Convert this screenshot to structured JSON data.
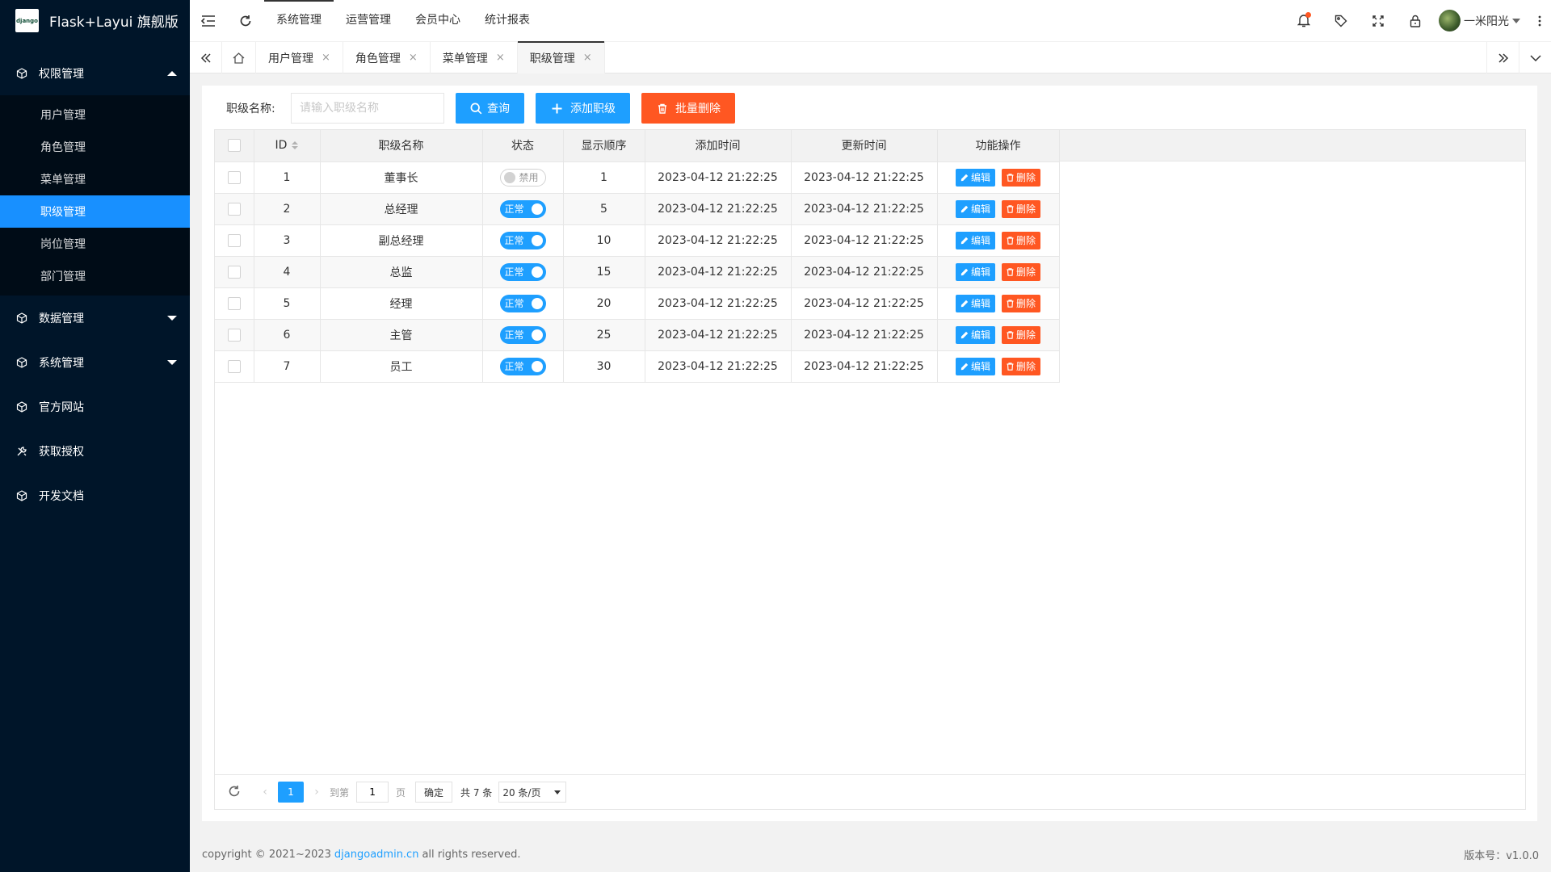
{
  "app": {
    "logo_text": "django",
    "title": "Flask+Layui 旗舰版"
  },
  "sidebar": {
    "groups": [
      {
        "label": "权限管理",
        "items": [
          "用户管理",
          "角色管理",
          "菜单管理",
          "职级管理",
          "岗位管理",
          "部门管理"
        ],
        "active_item": "职级管理"
      },
      {
        "label": "数据管理"
      },
      {
        "label": "系统管理"
      },
      {
        "label": "官方网站"
      },
      {
        "label": "获取授权"
      },
      {
        "label": "开发文档"
      }
    ]
  },
  "header": {
    "nav": [
      "系统管理",
      "运营管理",
      "会员中心",
      "统计报表"
    ],
    "active_nav": "系统管理",
    "user_name": "一米阳光"
  },
  "tabs": [
    {
      "label": "用户管理"
    },
    {
      "label": "角色管理"
    },
    {
      "label": "菜单管理"
    },
    {
      "label": "职级管理",
      "active": true
    }
  ],
  "search": {
    "label": "职级名称:",
    "placeholder": "请输入职级名称",
    "query_button": "查询",
    "add_button": "添加职级",
    "batch_delete_button": "批量删除"
  },
  "table": {
    "columns": [
      "ID",
      "职级名称",
      "状态",
      "显示顺序",
      "添加时间",
      "更新时间",
      "功能操作"
    ],
    "rows": [
      {
        "id": "1",
        "name": "董事长",
        "status": "禁用",
        "status_on": false,
        "order": "1",
        "created": "2023-04-12 21:22:25",
        "updated": "2023-04-12 21:22:25"
      },
      {
        "id": "2",
        "name": "总经理",
        "status": "正常",
        "status_on": true,
        "order": "5",
        "created": "2023-04-12 21:22:25",
        "updated": "2023-04-12 21:22:25"
      },
      {
        "id": "3",
        "name": "副总经理",
        "status": "正常",
        "status_on": true,
        "order": "10",
        "created": "2023-04-12 21:22:25",
        "updated": "2023-04-12 21:22:25"
      },
      {
        "id": "4",
        "name": "总监",
        "status": "正常",
        "status_on": true,
        "order": "15",
        "created": "2023-04-12 21:22:25",
        "updated": "2023-04-12 21:22:25"
      },
      {
        "id": "5",
        "name": "经理",
        "status": "正常",
        "status_on": true,
        "order": "20",
        "created": "2023-04-12 21:22:25",
        "updated": "2023-04-12 21:22:25"
      },
      {
        "id": "6",
        "name": "主管",
        "status": "正常",
        "status_on": true,
        "order": "25",
        "created": "2023-04-12 21:22:25",
        "updated": "2023-04-12 21:22:25"
      },
      {
        "id": "7",
        "name": "员工",
        "status": "正常",
        "status_on": true,
        "order": "30",
        "created": "2023-04-12 21:22:25",
        "updated": "2023-04-12 21:22:25"
      }
    ],
    "edit_label": "编辑",
    "delete_label": "删除"
  },
  "pagination": {
    "current_page": "1",
    "goto_label": "到第",
    "goto_value": "1",
    "page_unit": "页",
    "confirm": "确定",
    "total": "共 7 条",
    "page_size": "20 条/页"
  },
  "footer": {
    "copyright_prefix": "copyright © 2021~2023",
    "link_text": "djangoadmin.cn",
    "copyright_suffix": "all rights reserved.",
    "version": "版本号：v1.0.0"
  },
  "colors": {
    "sidebar_bg": "#001529",
    "active_blue": "#1890ff",
    "primary": "#1e9fff",
    "danger": "#ff5722"
  }
}
